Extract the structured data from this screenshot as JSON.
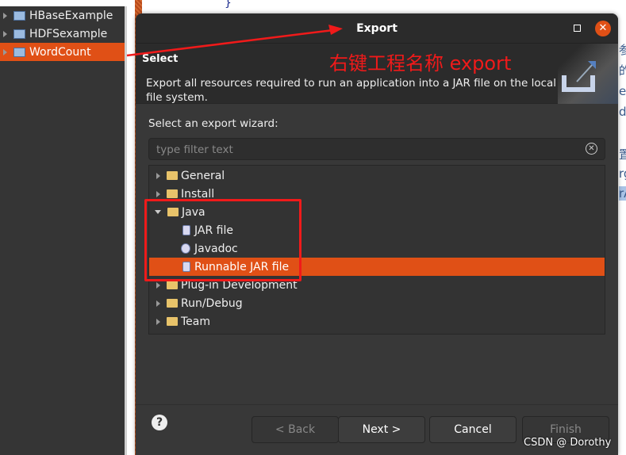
{
  "project_explorer": {
    "items": [
      {
        "label": "HBaseExample"
      },
      {
        "label": "HDFSexample"
      },
      {
        "label": "WordCount",
        "selected": true
      }
    ]
  },
  "editor": {
    "brace": "}",
    "background_fragments": [
      "参",
      "的",
      "er",
      "du",
      "置",
      "rg",
      "rA"
    ]
  },
  "dialog": {
    "title": "Export",
    "header": {
      "heading": "Select",
      "description": "Export all resources required to run an application into a JAR file on the local file system."
    },
    "wizard_label": "Select an export wizard:",
    "filter": {
      "value": "",
      "placeholder": "type filter text"
    },
    "tree": [
      {
        "label": "General",
        "level": 0,
        "expanded": false
      },
      {
        "label": "Install",
        "level": 0,
        "expanded": false
      },
      {
        "label": "Java",
        "level": 0,
        "expanded": true
      },
      {
        "label": "JAR file",
        "level": 1
      },
      {
        "label": "Javadoc",
        "level": 1
      },
      {
        "label": "Runnable JAR file",
        "level": 1,
        "selected": true
      },
      {
        "label": "Plug-in Development",
        "level": 0,
        "expanded": false
      },
      {
        "label": "Run/Debug",
        "level": 0,
        "expanded": false
      },
      {
        "label": "Team",
        "level": 0,
        "expanded": false
      }
    ],
    "buttons": {
      "back": "< Back",
      "next": "Next >",
      "cancel": "Cancel",
      "finish": "Finish"
    }
  },
  "annotation": {
    "text": "右键工程名称 export",
    "color": "#f01a1a"
  },
  "watermark": "CSDN @  Dorothy",
  "colors": {
    "accent": "#e05016"
  }
}
